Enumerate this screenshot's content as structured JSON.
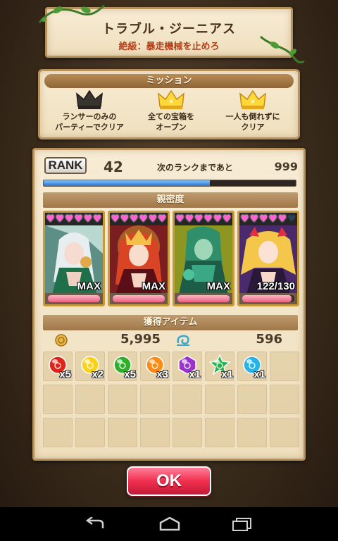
{
  "title": {
    "main": "トラブル・ジーニアス",
    "sub": "絶級：暴走機械を止めろ"
  },
  "mission": {
    "header": "ミッション",
    "items": [
      {
        "line1": "ランサーのみの",
        "line2": "パーティーでクリア",
        "achieved": false,
        "icon": "crown-icon"
      },
      {
        "line1": "全ての宝箱を",
        "line2": "オープン",
        "achieved": true,
        "icon": "crown-icon"
      },
      {
        "line1": "一人も倒れずに",
        "line2": "クリア",
        "achieved": true,
        "icon": "crown-icon"
      }
    ]
  },
  "rank": {
    "label": "RANK",
    "value": "42",
    "next_label": "次のランクまであと",
    "next_value": "999",
    "progress": 0.66
  },
  "affinity": {
    "header": "親密度",
    "cards": [
      {
        "hearts_full": 6,
        "hearts_total": 6,
        "level": "MAX",
        "bond": 1.0
      },
      {
        "hearts_full": 6,
        "hearts_total": 6,
        "level": "MAX",
        "bond": 1.0
      },
      {
        "hearts_full": 6,
        "hearts_total": 6,
        "level": "MAX",
        "bond": 1.0
      },
      {
        "hearts_full": 5,
        "hearts_total": 6,
        "level": "122/130",
        "bond": 0.94
      }
    ]
  },
  "items": {
    "header": "獲得アイテム",
    "gold": "5,995",
    "gold_icon": "coin-icon",
    "points": "596",
    "points_icon": "swirl-icon",
    "list": [
      {
        "color": "#e2231a",
        "shape": "round",
        "qty": "x5"
      },
      {
        "color": "#ffd21a",
        "shape": "round",
        "qty": "x2"
      },
      {
        "color": "#2fae2a",
        "shape": "round",
        "qty": "x5"
      },
      {
        "color": "#ff8a12",
        "shape": "round",
        "qty": "x3"
      },
      {
        "color": "#9a33c8",
        "shape": "hex",
        "qty": "x1"
      },
      {
        "color": "#22b14c",
        "shape": "star",
        "qty": "x1"
      },
      {
        "color": "#26b3e6",
        "shape": "round",
        "qty": "x1"
      }
    ]
  },
  "ok_label": "OK",
  "nav": {
    "back_icon": "back-icon",
    "home_icon": "home-icon",
    "recent_icon": "recent-apps-icon"
  }
}
